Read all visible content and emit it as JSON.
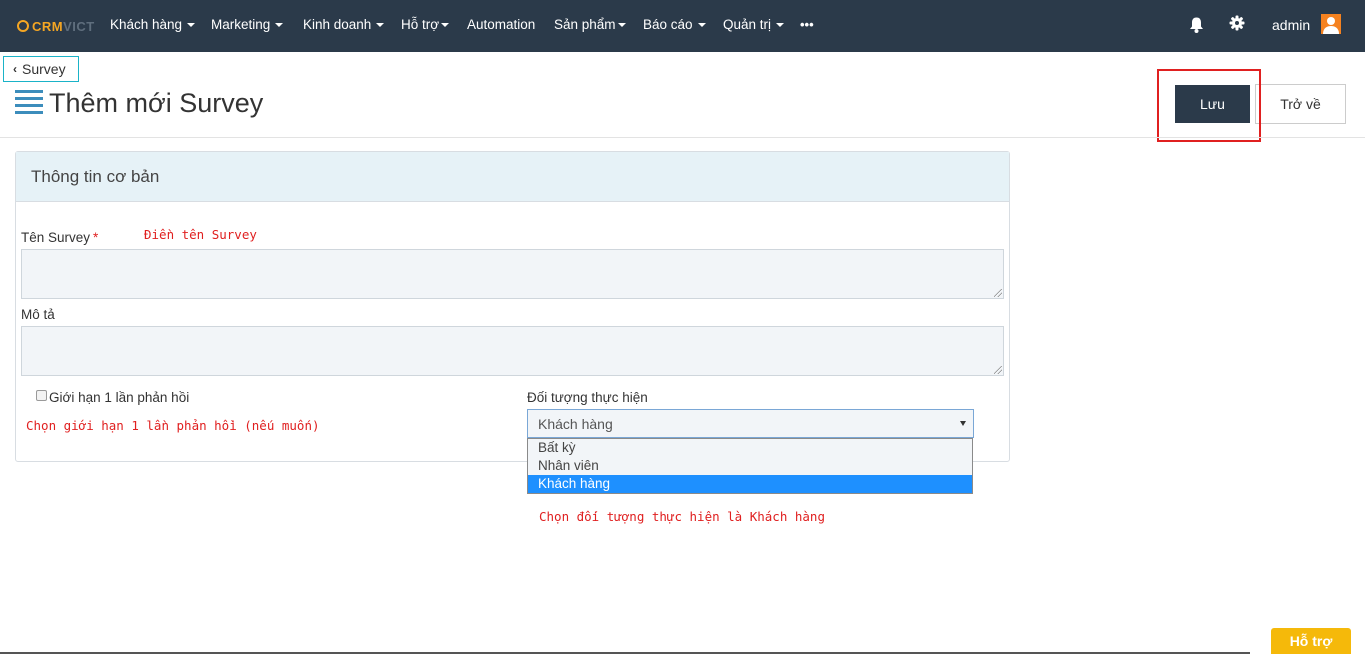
{
  "app": {
    "logo_part1": "CRM",
    "logo_part2": "VICT"
  },
  "nav": {
    "items": [
      {
        "label": "Khách hàng",
        "caret": true
      },
      {
        "label": "Marketing",
        "caret": true
      },
      {
        "label": "Kinh doanh",
        "caret": true
      },
      {
        "label": "Hỗ trợ",
        "caret": true
      },
      {
        "label": "Automation",
        "caret": false
      },
      {
        "label": "Sản phẩm",
        "caret": true
      },
      {
        "label": "Báo cáo",
        "caret": true
      },
      {
        "label": "Quản trị",
        "caret": true
      }
    ],
    "more": "•••",
    "user": "admin"
  },
  "breadcrumb": {
    "back_label": "Survey"
  },
  "page": {
    "title": "Thêm mới Survey"
  },
  "actions": {
    "save": "Lưu",
    "back": "Trở về"
  },
  "panel": {
    "title": "Thông tin cơ bản"
  },
  "form": {
    "name_label": "Tên Survey",
    "name_required": "*",
    "name_value": "",
    "desc_label": "Mô tả",
    "desc_value": "",
    "limit_label": "Giới hạn 1 lần phản hồi",
    "limit_checked": false,
    "target_label": "Đối tượng thực hiện",
    "target_selected": "Khách hàng",
    "target_options": [
      "Bất kỳ",
      "Nhân viên",
      "Khách hàng"
    ]
  },
  "annotations": {
    "name_hint": "Điền tên Survey",
    "limit_hint": "Chọn giới hạn 1 lần phản hồi (nếu muốn)",
    "target_hint": "Chọn đối tượng thực hiện là Khách hàng"
  },
  "support": {
    "label": "Hỗ trợ"
  },
  "colors": {
    "navbar": "#2b3a4a",
    "accent": "#f5a623",
    "annotation": "#e02020",
    "selected": "#1e90ff",
    "support": "#f5b90a"
  },
  "icons": [
    "bell-icon",
    "gear-icon",
    "avatar-icon",
    "list-icon",
    "chevron-left-icon",
    "caret-down-icon"
  ]
}
